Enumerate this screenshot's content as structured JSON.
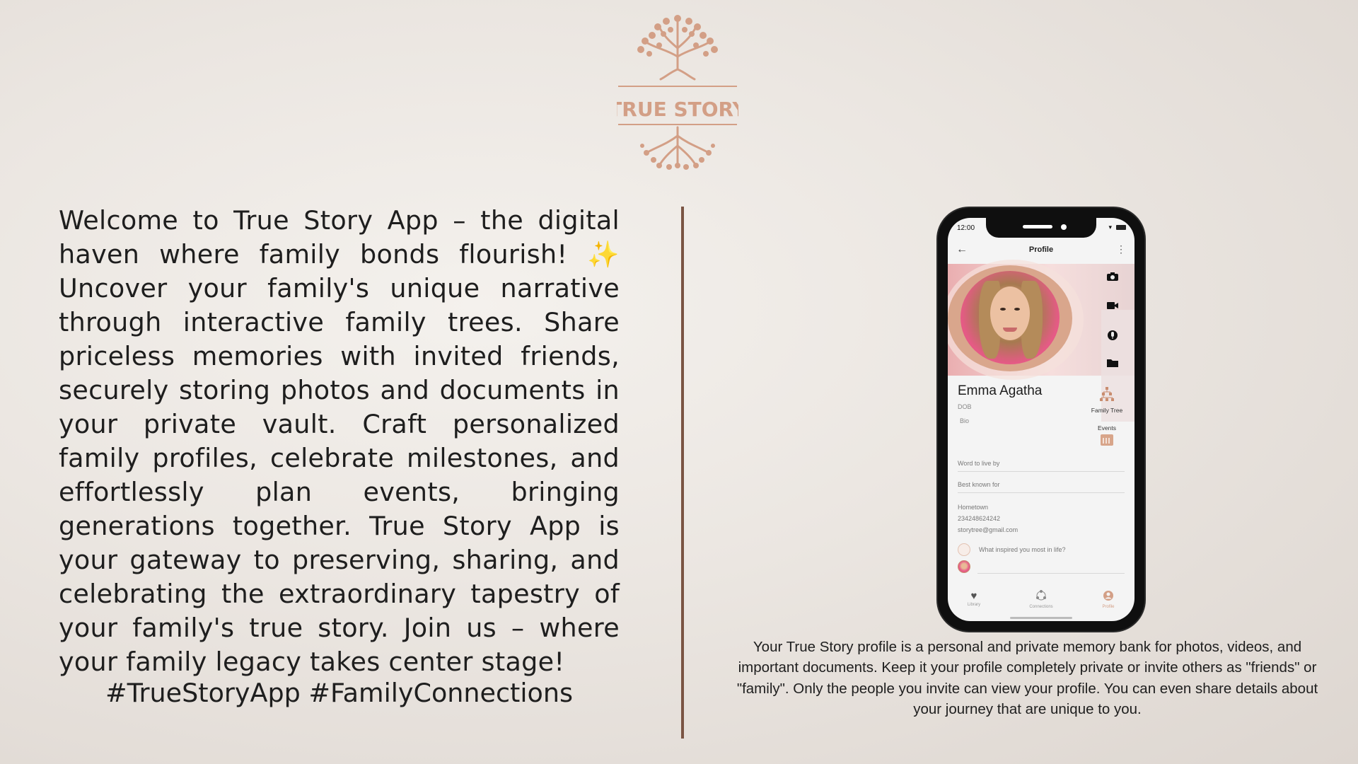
{
  "logo": {
    "text": "TRUE STORY",
    "color": "#d39f86",
    "icon": "tree-of-life-icon"
  },
  "intro": {
    "text": "Welcome to True Story App – the digital haven where family bonds flourish! ✨ Uncover your family's unique narrative through interactive family trees. Share priceless memories with invited friends, securely storing photos and documents in your private vault. Craft personalized family profiles, celebrate milestones, and effortlessly plan events, bringing generations together. True Story App is your gateway to preserving, sharing, and celebrating the extraordinary tapestry of your family's true story. Join us – where your family legacy takes center stage!"
  },
  "hashtags": "#TrueStoryApp #FamilyConnections",
  "divider_color": "#7a5443",
  "caption": "Your True Story profile is a personal and private memory bank for photos, videos, and important documents. Keep it your profile completely private or invite others as \"friends\" or \"family\". Only the people you invite can view your profile. You can even share details about your journey that are unique to you.",
  "phone": {
    "status": {
      "time": "12:00"
    },
    "header": {
      "title": "Profile",
      "back_icon": "arrow-left-icon",
      "menu_icon": "more-vertical-icon"
    },
    "profile": {
      "name": "Emma Agatha",
      "dob_label": "DOB",
      "bio_label": "Bio",
      "family_tree_label": "Family Tree",
      "events_label": "Events",
      "word_to_live_by": "Word to live by",
      "best_known_for": "Best known for",
      "hometown": "Hometown",
      "phone": "234248624242",
      "email": "storytree@gmail.com",
      "question": "What inspired you most in life?"
    },
    "tools": [
      "camera-icon",
      "video-icon",
      "microphone-icon",
      "folder-icon"
    ],
    "nav": [
      {
        "label": "Library",
        "icon": "heart-icon"
      },
      {
        "label": "Connections",
        "icon": "network-icon"
      },
      {
        "label": "Profile",
        "icon": "user-icon"
      }
    ],
    "accent": "#d39f86"
  }
}
